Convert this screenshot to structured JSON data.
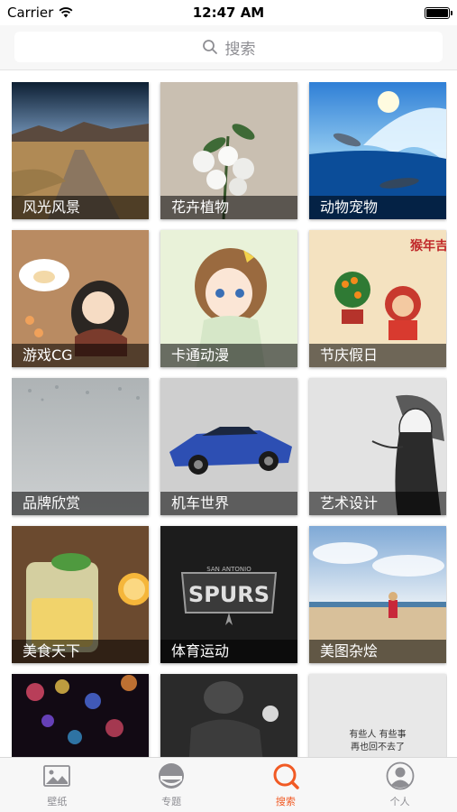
{
  "status_bar": {
    "carrier": "Carrier",
    "time": "12:47 AM"
  },
  "search": {
    "placeholder": "搜索"
  },
  "categories": [
    {
      "label": "风光风景"
    },
    {
      "label": "花卉植物"
    },
    {
      "label": "动物宠物"
    },
    {
      "label": "游戏CG"
    },
    {
      "label": "卡通动漫"
    },
    {
      "label": "节庆假日"
    },
    {
      "label": "品牌欣赏"
    },
    {
      "label": "机车世界"
    },
    {
      "label": "艺术设计"
    },
    {
      "label": "美食天下"
    },
    {
      "label": "体育运动"
    },
    {
      "label": "美图杂烩"
    },
    {
      "label": ""
    },
    {
      "label": ""
    },
    {
      "label": ""
    }
  ],
  "tile_artwork_text": {
    "spurs_top": "SAN ANTONIO",
    "spurs_main": "SPURS",
    "festival_text": "猴年吉祥",
    "quote_line1": "有些人 有些事",
    "quote_line2": "再也回不去了"
  },
  "tab_bar": {
    "tabs": [
      {
        "label": "壁纸",
        "icon": "image-icon"
      },
      {
        "label": "专题",
        "icon": "topic-icon"
      },
      {
        "label": "搜索",
        "icon": "search-icon"
      },
      {
        "label": "个人",
        "icon": "person-icon"
      }
    ],
    "active_index": 2
  },
  "colors": {
    "accent": "#f15a24",
    "tab_inactive": "#8e8e93"
  }
}
